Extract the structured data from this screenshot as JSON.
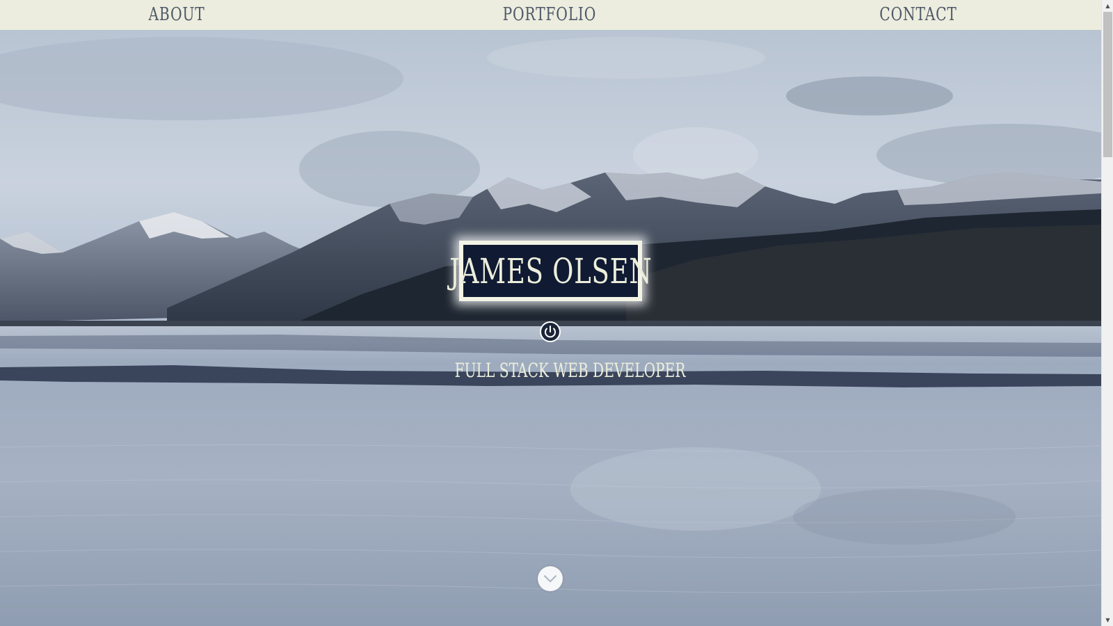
{
  "nav": {
    "about": "About",
    "portfolio": "Portfolio",
    "contact": "Contact"
  },
  "hero": {
    "name": "James Olsen",
    "tagline": "Full Stack Web Developer",
    "power_icon": "power-icon",
    "scroll_icon": "chevron-down-icon"
  },
  "scrollbar": {
    "up_glyph": "▲",
    "down_glyph": "▼"
  },
  "colors": {
    "nav_background": "#ecedde",
    "nav_text": "#4e5968",
    "name_box_background": "#101a33",
    "name_text": "#eceedb",
    "sky": "#c0cad8",
    "water": "#a3afc1"
  }
}
